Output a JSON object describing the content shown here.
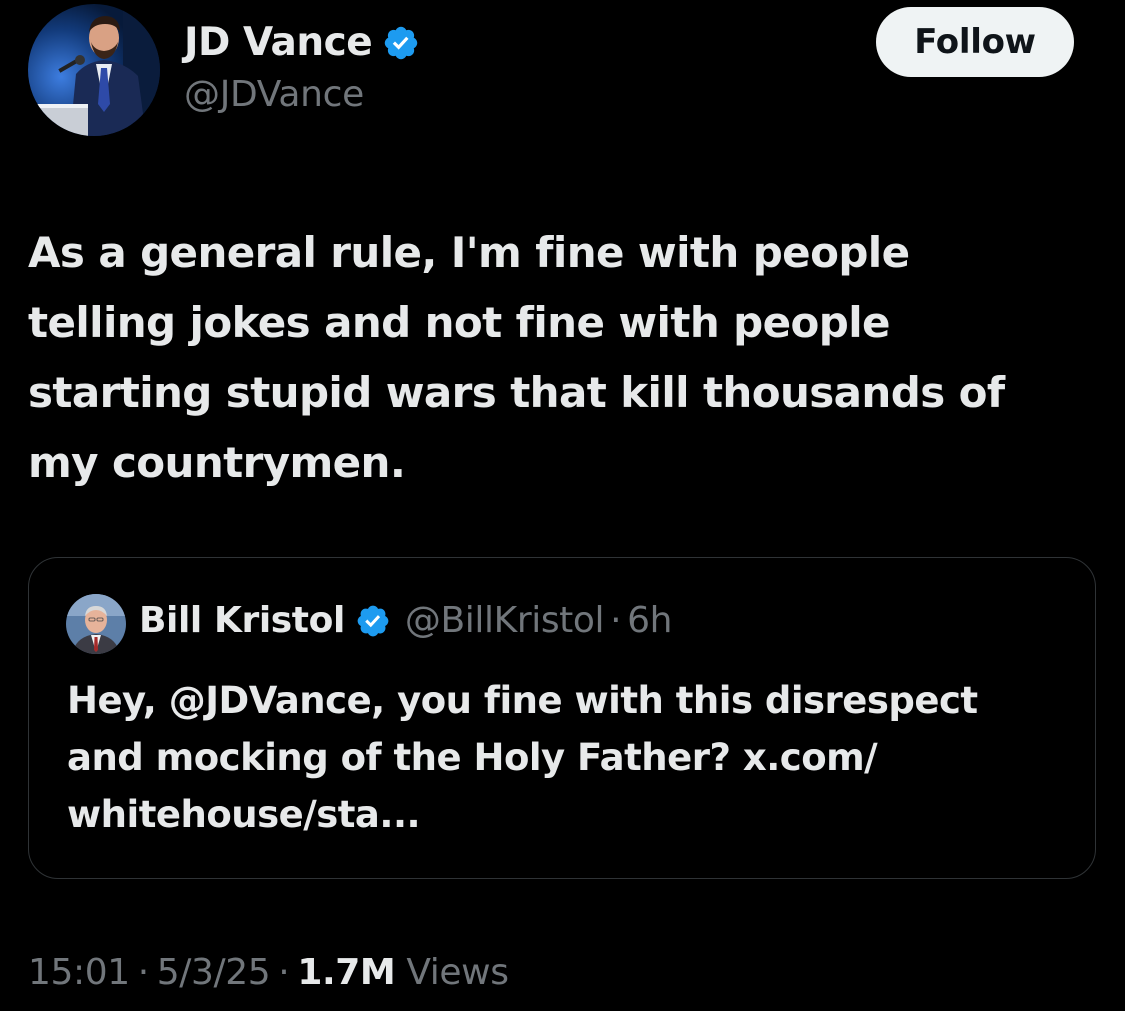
{
  "author": {
    "name": "JD Vance",
    "handle": "@JDVance",
    "verified": true
  },
  "follow_button": {
    "label": "Follow"
  },
  "tweet": {
    "text": "As a general rule, I'm fine with people\ntelling jokes and not fine with people\nstarting stupid wars that kill thousands of\nmy countrymen."
  },
  "quoted_tweet": {
    "name": "Bill Kristol",
    "handle": "@BillKristol",
    "separator": "·",
    "time": "6h",
    "verified": true,
    "text": "Hey, @JDVance, you fine with this disrespect\nand mocking of the Holy Father? x.com/\nwhitehouse/sta..."
  },
  "meta": {
    "time": "15:01",
    "date": "5/3/25",
    "views_count": "1.7M",
    "views_label": "Views",
    "separator": "·"
  },
  "colors": {
    "background": "#000000",
    "primary_text": "#e7e9ea",
    "secondary_text": "#71767b",
    "verified_badge": "#1d9bf0",
    "follow_button_bg": "#eff3f4",
    "border": "#2f3336"
  },
  "icons": {
    "verified": "verified-badge-icon"
  }
}
